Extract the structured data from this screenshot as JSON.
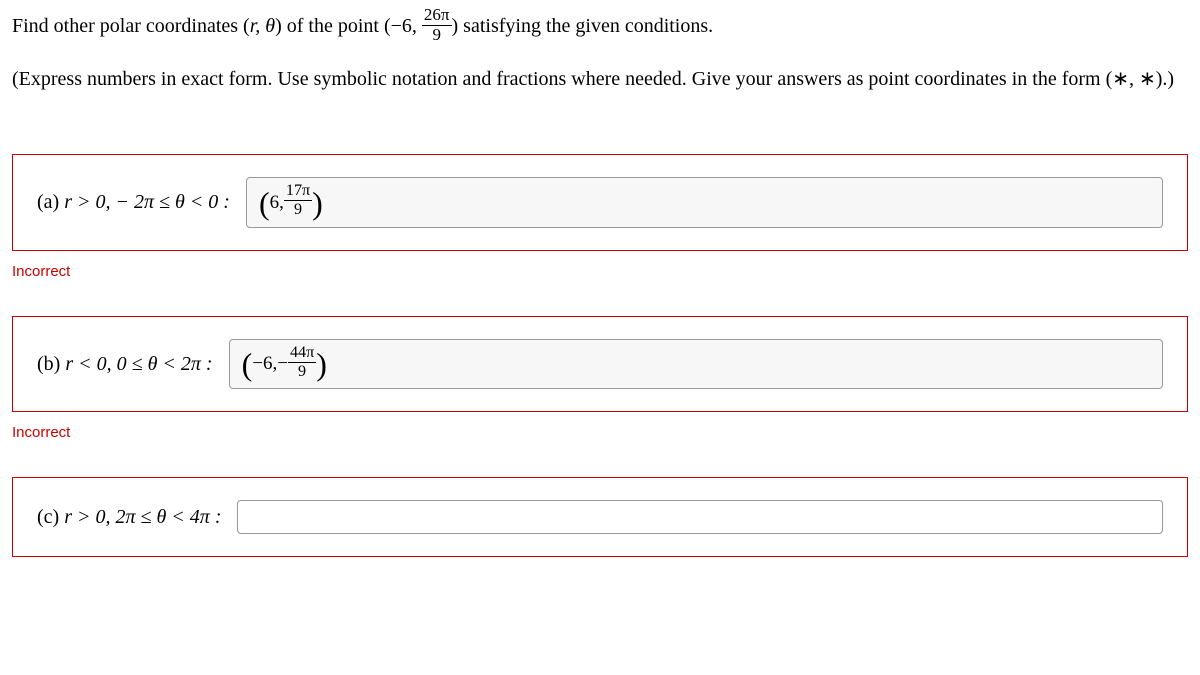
{
  "question_prefix": "Find other polar coordinates (",
  "question_rtheta": "r, θ",
  "question_mid": ") of the point (−6, ",
  "question_frac_num": "26π",
  "question_frac_den": "9",
  "question_suffix": ") satisfying the given conditions.",
  "instruction": "(Express numbers in exact form. Use symbolic notation and fractions where needed. Give your answers as point coordinates in the form (∗, ∗).)",
  "parts": {
    "a": {
      "label_prefix": "(a) ",
      "condition": "r > 0,  − 2π ≤ θ < 0 :",
      "answer_prefix": "6, ",
      "answer_frac_num": "17π",
      "answer_frac_den": "9",
      "status": "Incorrect"
    },
    "b": {
      "label_prefix": "(b) ",
      "condition": "r < 0, 0 ≤ θ < 2π :",
      "answer_prefix": "−6,− ",
      "answer_frac_num": "44π",
      "answer_frac_den": "9",
      "status": "Incorrect"
    },
    "c": {
      "label_prefix": "(c) ",
      "condition": "r > 0, 2π ≤ θ < 4π :"
    }
  }
}
